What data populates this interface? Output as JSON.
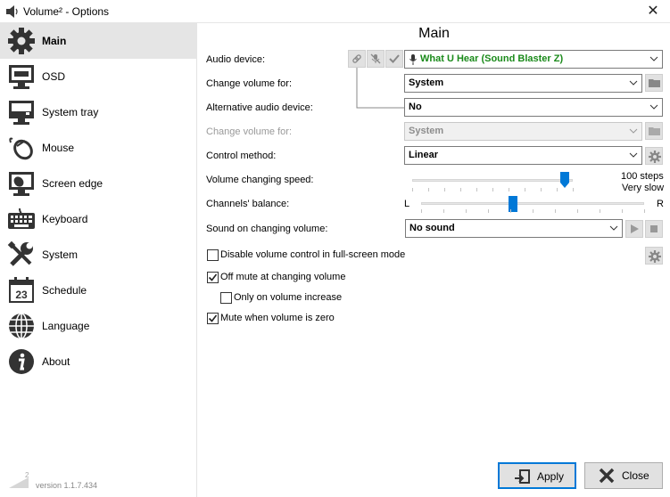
{
  "window": {
    "title": "Volume² - Options",
    "close_glyph": "✕"
  },
  "sidebar": {
    "items": [
      {
        "label": "Main",
        "icon": "gear-icon"
      },
      {
        "label": "OSD",
        "icon": "monitor-icon"
      },
      {
        "label": "System tray",
        "icon": "tray-icon"
      },
      {
        "label": "Mouse",
        "icon": "mouse-icon"
      },
      {
        "label": "Screen edge",
        "icon": "screen-edge-icon"
      },
      {
        "label": "Keyboard",
        "icon": "keyboard-icon"
      },
      {
        "label": "System",
        "icon": "wrench-screwdriver-icon"
      },
      {
        "label": "Schedule",
        "icon": "calendar-icon"
      },
      {
        "label": "Language",
        "icon": "globe-icon"
      },
      {
        "label": "About",
        "icon": "info-icon"
      }
    ],
    "active_index": 0,
    "calendar_day": "23",
    "version": "version 1.1.7.434",
    "logo_text": "2"
  },
  "main": {
    "heading": "Main",
    "audio_device": {
      "label": "Audio device:",
      "value": "What U Hear (Sound Blaster Z)",
      "value_color": "#1a8a1a"
    },
    "change_volume_for": {
      "label": "Change volume for:",
      "value": "System"
    },
    "alt_audio_device": {
      "label": "Alternative audio device:",
      "value": "No"
    },
    "change_volume_for_alt": {
      "label": "Change volume for:",
      "value": "System",
      "disabled": true
    },
    "control_method": {
      "label": "Control method:",
      "value": "Linear"
    },
    "speed": {
      "label": "Volume changing speed:",
      "value_fraction": 0.95,
      "caption_line1": "100 steps",
      "caption_line2": "Very slow"
    },
    "balance": {
      "label": "Channels' balance:",
      "left": "L",
      "right": "R",
      "value_fraction": 0.41
    },
    "sound": {
      "label": "Sound on changing volume:",
      "value": "No sound"
    },
    "checkboxes": {
      "fullscreen": {
        "label": "Disable volume control in full-screen mode",
        "checked": false
      },
      "off_mute": {
        "label": "Off mute at changing volume",
        "checked": true
      },
      "only_increase": {
        "label": "Only on volume increase",
        "checked": false
      },
      "mute_zero": {
        "label": "Mute when volume is zero",
        "checked": true
      }
    }
  },
  "footer": {
    "apply": "Apply",
    "close": "Close"
  },
  "colors": {
    "accent": "#0078d7",
    "active_bg": "#e5e5e5",
    "button_bg": "#e1e1e1"
  }
}
